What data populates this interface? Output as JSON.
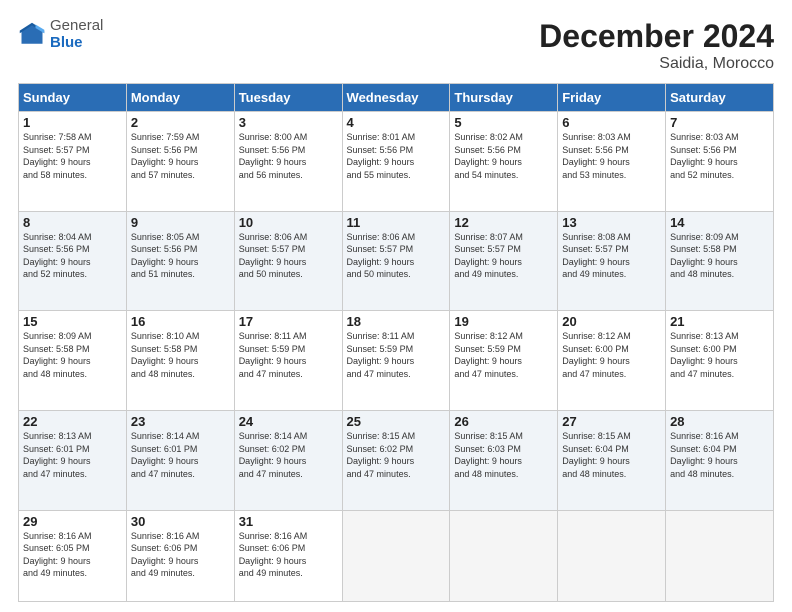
{
  "header": {
    "logo_general": "General",
    "logo_blue": "Blue",
    "title": "December 2024",
    "subtitle": "Saidia, Morocco"
  },
  "weekdays": [
    "Sunday",
    "Monday",
    "Tuesday",
    "Wednesday",
    "Thursday",
    "Friday",
    "Saturday"
  ],
  "weeks": [
    [
      {
        "day": 1,
        "info": "Sunrise: 7:58 AM\nSunset: 5:57 PM\nDaylight: 9 hours\nand 58 minutes."
      },
      {
        "day": 2,
        "info": "Sunrise: 7:59 AM\nSunset: 5:56 PM\nDaylight: 9 hours\nand 57 minutes."
      },
      {
        "day": 3,
        "info": "Sunrise: 8:00 AM\nSunset: 5:56 PM\nDaylight: 9 hours\nand 56 minutes."
      },
      {
        "day": 4,
        "info": "Sunrise: 8:01 AM\nSunset: 5:56 PM\nDaylight: 9 hours\nand 55 minutes."
      },
      {
        "day": 5,
        "info": "Sunrise: 8:02 AM\nSunset: 5:56 PM\nDaylight: 9 hours\nand 54 minutes."
      },
      {
        "day": 6,
        "info": "Sunrise: 8:03 AM\nSunset: 5:56 PM\nDaylight: 9 hours\nand 53 minutes."
      },
      {
        "day": 7,
        "info": "Sunrise: 8:03 AM\nSunset: 5:56 PM\nDaylight: 9 hours\nand 52 minutes."
      }
    ],
    [
      {
        "day": 8,
        "info": "Sunrise: 8:04 AM\nSunset: 5:56 PM\nDaylight: 9 hours\nand 52 minutes."
      },
      {
        "day": 9,
        "info": "Sunrise: 8:05 AM\nSunset: 5:56 PM\nDaylight: 9 hours\nand 51 minutes."
      },
      {
        "day": 10,
        "info": "Sunrise: 8:06 AM\nSunset: 5:57 PM\nDaylight: 9 hours\nand 50 minutes."
      },
      {
        "day": 11,
        "info": "Sunrise: 8:06 AM\nSunset: 5:57 PM\nDaylight: 9 hours\nand 50 minutes."
      },
      {
        "day": 12,
        "info": "Sunrise: 8:07 AM\nSunset: 5:57 PM\nDaylight: 9 hours\nand 49 minutes."
      },
      {
        "day": 13,
        "info": "Sunrise: 8:08 AM\nSunset: 5:57 PM\nDaylight: 9 hours\nand 49 minutes."
      },
      {
        "day": 14,
        "info": "Sunrise: 8:09 AM\nSunset: 5:58 PM\nDaylight: 9 hours\nand 48 minutes."
      }
    ],
    [
      {
        "day": 15,
        "info": "Sunrise: 8:09 AM\nSunset: 5:58 PM\nDaylight: 9 hours\nand 48 minutes."
      },
      {
        "day": 16,
        "info": "Sunrise: 8:10 AM\nSunset: 5:58 PM\nDaylight: 9 hours\nand 48 minutes."
      },
      {
        "day": 17,
        "info": "Sunrise: 8:11 AM\nSunset: 5:59 PM\nDaylight: 9 hours\nand 47 minutes."
      },
      {
        "day": 18,
        "info": "Sunrise: 8:11 AM\nSunset: 5:59 PM\nDaylight: 9 hours\nand 47 minutes."
      },
      {
        "day": 19,
        "info": "Sunrise: 8:12 AM\nSunset: 5:59 PM\nDaylight: 9 hours\nand 47 minutes."
      },
      {
        "day": 20,
        "info": "Sunrise: 8:12 AM\nSunset: 6:00 PM\nDaylight: 9 hours\nand 47 minutes."
      },
      {
        "day": 21,
        "info": "Sunrise: 8:13 AM\nSunset: 6:00 PM\nDaylight: 9 hours\nand 47 minutes."
      }
    ],
    [
      {
        "day": 22,
        "info": "Sunrise: 8:13 AM\nSunset: 6:01 PM\nDaylight: 9 hours\nand 47 minutes."
      },
      {
        "day": 23,
        "info": "Sunrise: 8:14 AM\nSunset: 6:01 PM\nDaylight: 9 hours\nand 47 minutes."
      },
      {
        "day": 24,
        "info": "Sunrise: 8:14 AM\nSunset: 6:02 PM\nDaylight: 9 hours\nand 47 minutes."
      },
      {
        "day": 25,
        "info": "Sunrise: 8:15 AM\nSunset: 6:02 PM\nDaylight: 9 hours\nand 47 minutes."
      },
      {
        "day": 26,
        "info": "Sunrise: 8:15 AM\nSunset: 6:03 PM\nDaylight: 9 hours\nand 48 minutes."
      },
      {
        "day": 27,
        "info": "Sunrise: 8:15 AM\nSunset: 6:04 PM\nDaylight: 9 hours\nand 48 minutes."
      },
      {
        "day": 28,
        "info": "Sunrise: 8:16 AM\nSunset: 6:04 PM\nDaylight: 9 hours\nand 48 minutes."
      }
    ],
    [
      {
        "day": 29,
        "info": "Sunrise: 8:16 AM\nSunset: 6:05 PM\nDaylight: 9 hours\nand 49 minutes."
      },
      {
        "day": 30,
        "info": "Sunrise: 8:16 AM\nSunset: 6:06 PM\nDaylight: 9 hours\nand 49 minutes."
      },
      {
        "day": 31,
        "info": "Sunrise: 8:16 AM\nSunset: 6:06 PM\nDaylight: 9 hours\nand 49 minutes."
      },
      null,
      null,
      null,
      null
    ]
  ]
}
